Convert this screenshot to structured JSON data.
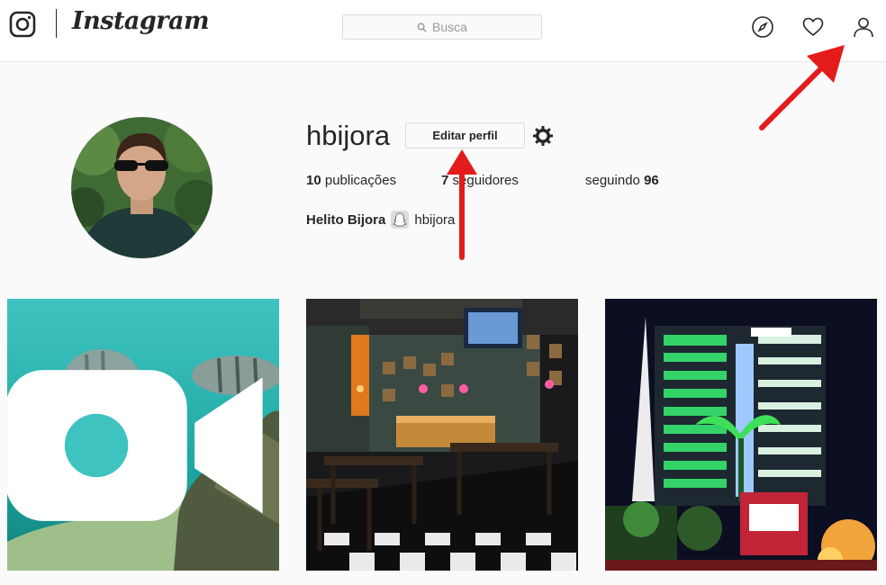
{
  "nav": {
    "brand": "Instagram",
    "search_placeholder": "Busca",
    "icons": [
      "instagram-glyph-icon",
      "explore-compass-icon",
      "heart-icon",
      "profile-user-icon"
    ]
  },
  "profile": {
    "username": "hbijora",
    "edit_button": "Editar perfil",
    "stats": {
      "posts_count": "10",
      "posts_label": "publicações",
      "followers_count": "7",
      "followers_label": "seguidores",
      "following_label": "seguindo",
      "following_count": "96"
    },
    "full_name": "Helito Bijora",
    "snapchat_handle": "hbijora"
  },
  "posts": [
    {
      "subject": "aquarium fish",
      "is_video": true
    },
    {
      "subject": "bar interior",
      "is_video": false
    },
    {
      "subject": "lit building at night",
      "is_video": false
    }
  ],
  "colors": {
    "annotation_arrow": "#e31b1b",
    "border": "#dbdbdb",
    "text": "#262626"
  }
}
